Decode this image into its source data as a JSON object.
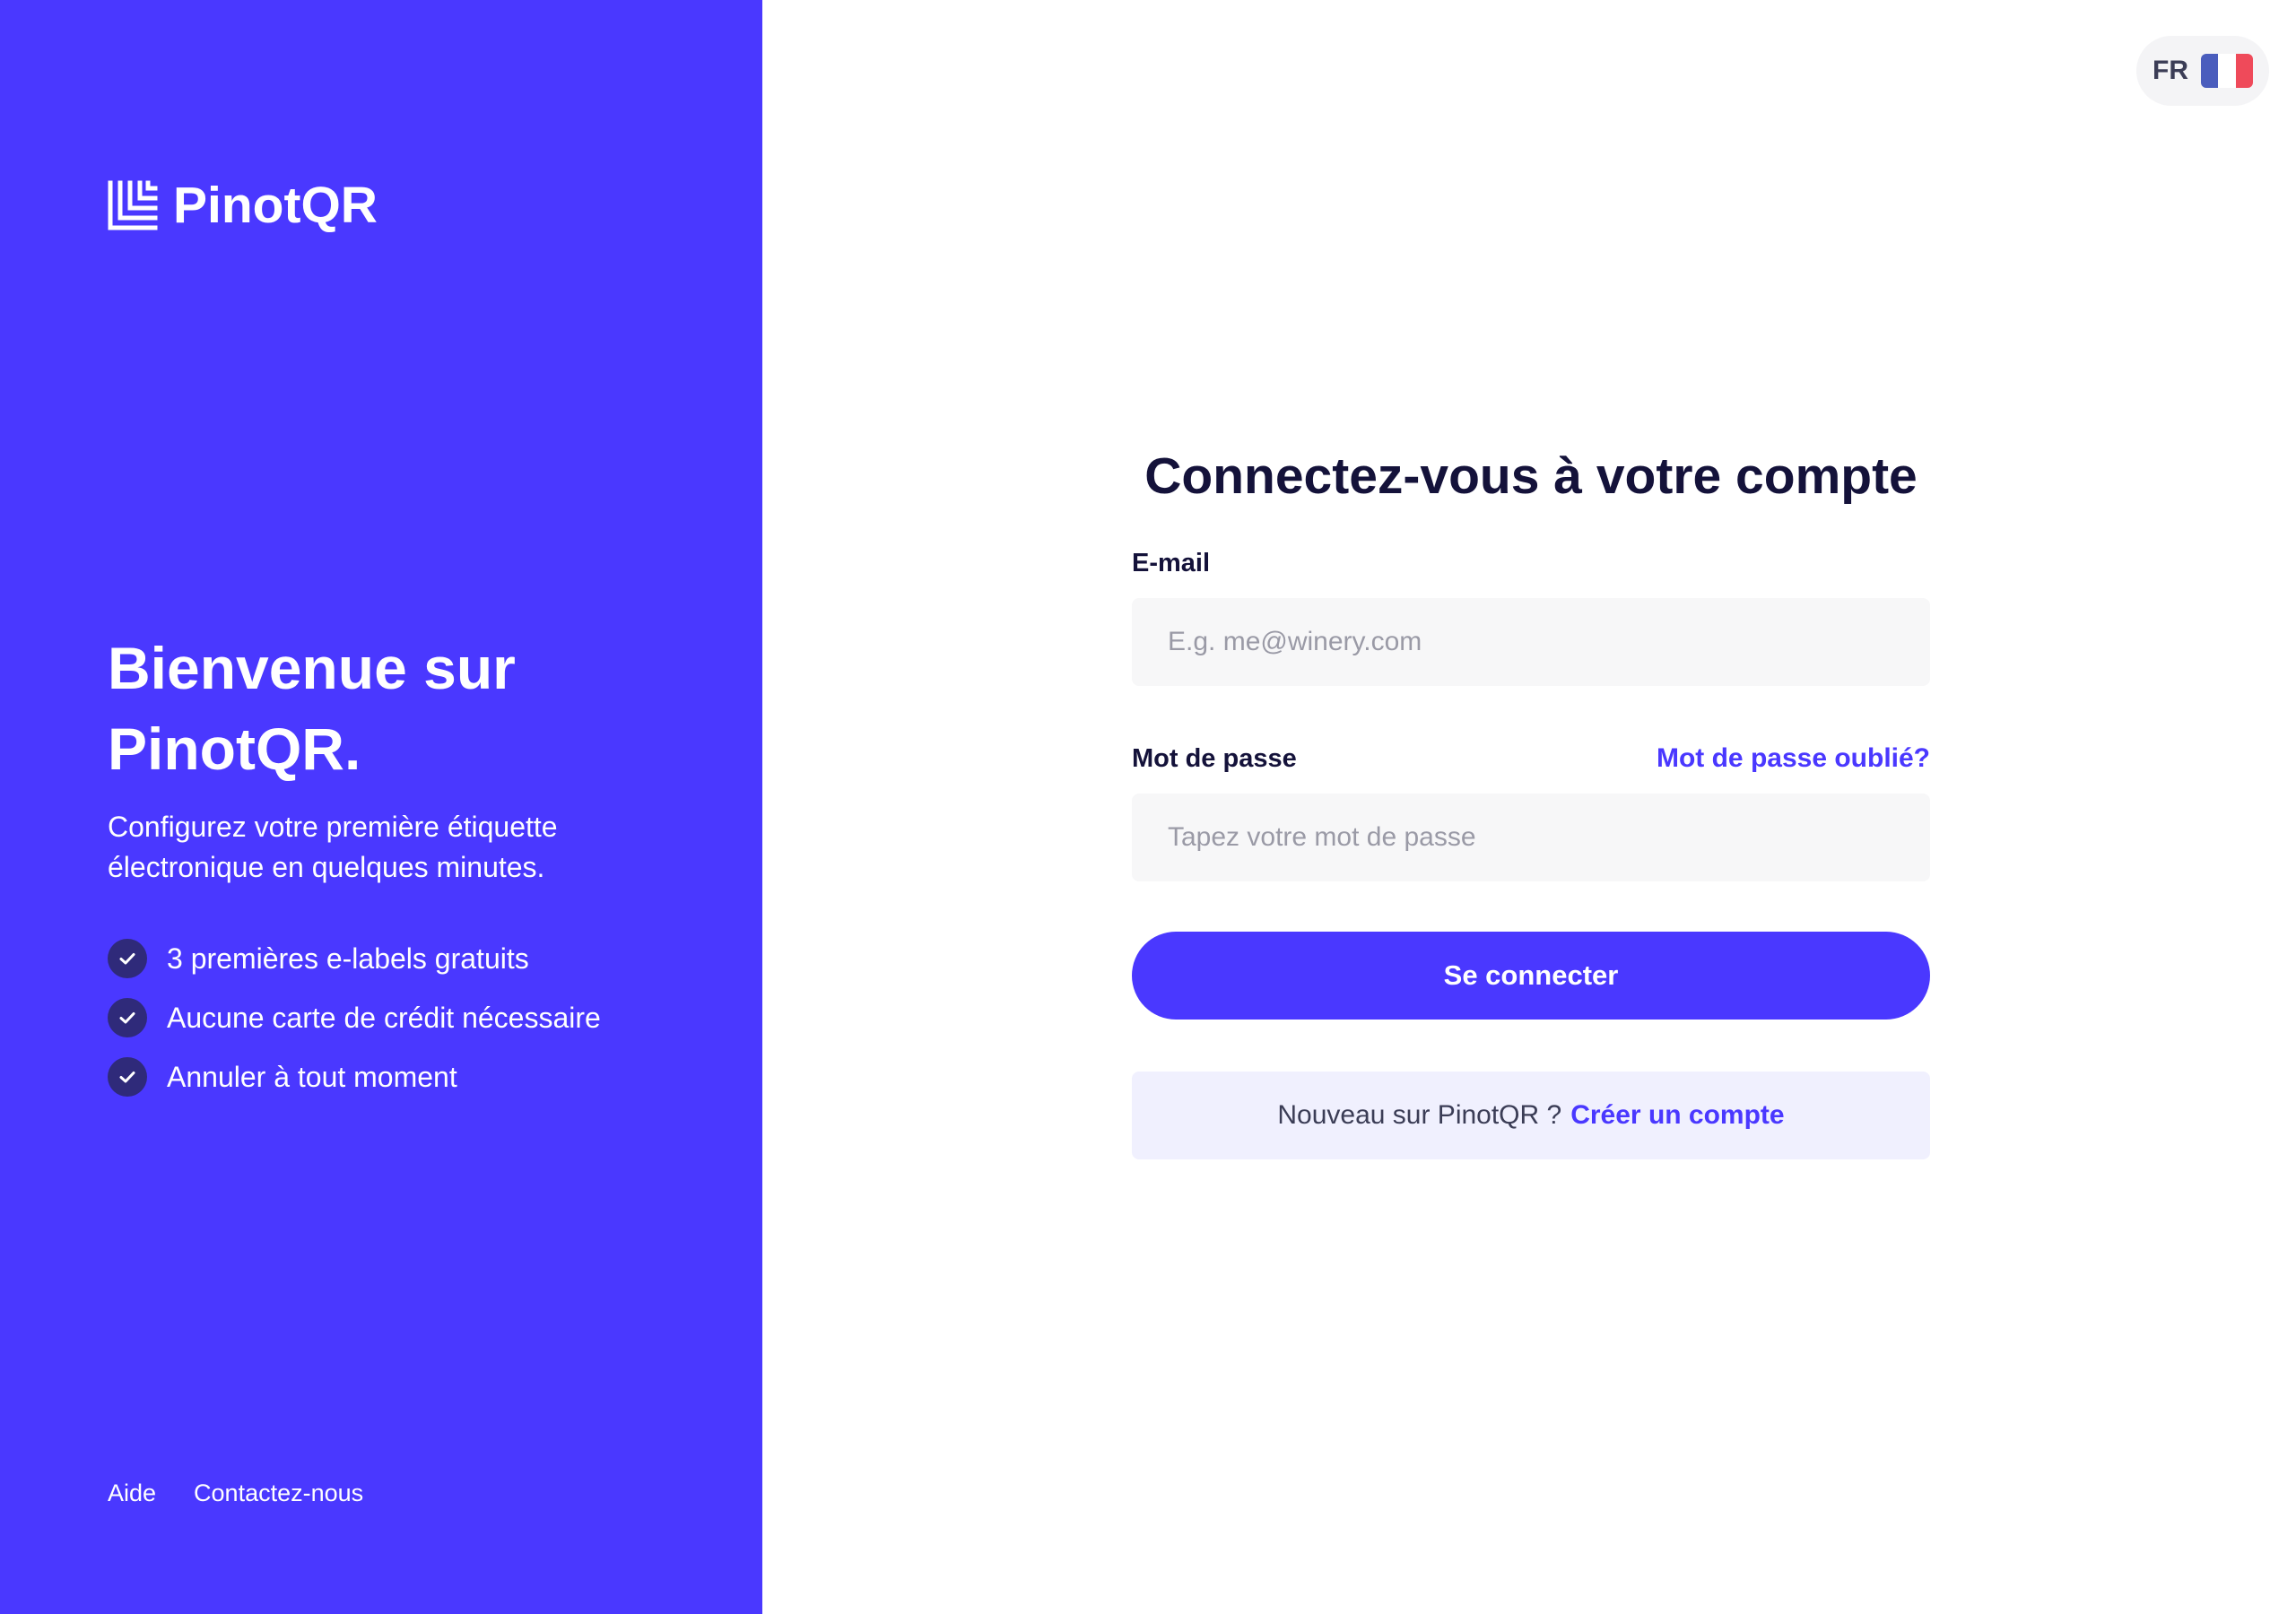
{
  "brand": {
    "name": "PinotQR",
    "color": "#4a38ff"
  },
  "left_panel": {
    "welcome_title_line1": "Bienvenue sur",
    "welcome_title_line2": "PinotQR.",
    "welcome_subtitle_line1": "Configurez votre première étiquette",
    "welcome_subtitle_line2": "électronique en quelques minutes.",
    "features": [
      {
        "text": "3 premières e-labels gratuits",
        "icon": "check-icon"
      },
      {
        "text": "Aucune carte de crédit nécessaire",
        "icon": "check-icon"
      },
      {
        "text": "Annuler à tout moment",
        "icon": "check-icon"
      }
    ],
    "footer_links": {
      "help": "Aide",
      "contact": "Contactez-nous"
    }
  },
  "language": {
    "code": "FR",
    "flag_icon": "france-flag-icon"
  },
  "login_form": {
    "title": "Connectez-vous à votre compte",
    "email": {
      "label": "E-mail",
      "value": "",
      "placeholder": "E.g. me@winery.com"
    },
    "password": {
      "label": "Mot de passe",
      "value": "",
      "placeholder": "Tapez votre mot de passe",
      "forgot_link": "Mot de passe oublié?"
    },
    "submit_label": "Se connecter",
    "signup_prompt": "Nouveau sur PinotQR ?",
    "signup_link": "Créer un compte"
  }
}
